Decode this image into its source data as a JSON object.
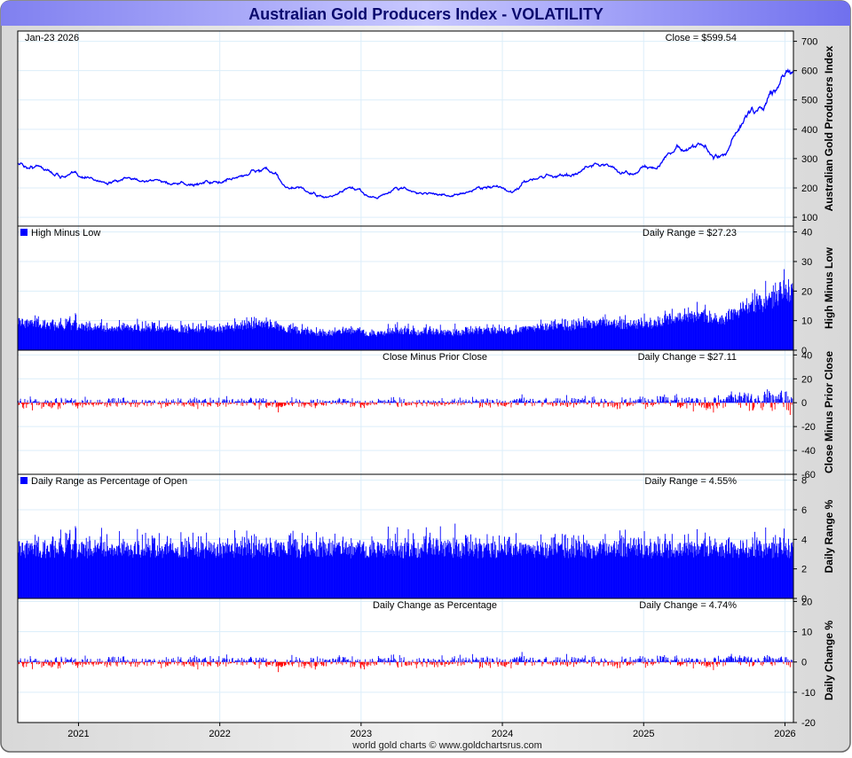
{
  "title": "Australian Gold Producers Index - VOLATILITY",
  "footer": "world gold charts © www.goldchartsrus.com",
  "date_label": "Jan-23  2026",
  "colors": {
    "line": "#0000ff",
    "negative": "#ff0000",
    "title_text": "#0a0a6e",
    "grid": "#dceefa"
  },
  "chart_data": [
    {
      "type": "line",
      "id": "close",
      "ylabel": "Australian Gold Producers Index",
      "annotation": "Close = $599.54",
      "ylim": [
        70,
        735
      ],
      "yticks": [
        100,
        200,
        300,
        400,
        500,
        600,
        700
      ],
      "x_start": 2020.57,
      "x_end": 2026.06,
      "xticks": [
        "2021",
        "2022",
        "2023",
        "2024",
        "2025",
        "2026"
      ],
      "monthly_close": [
        285,
        270,
        275,
        250,
        240,
        245,
        235,
        225,
        215,
        225,
        230,
        225,
        225,
        215,
        210,
        210,
        225,
        215,
        230,
        240,
        255,
        265,
        235,
        200,
        195,
        180,
        165,
        175,
        195,
        190,
        170,
        175,
        200,
        195,
        180,
        185,
        175,
        175,
        180,
        200,
        205,
        200,
        185,
        215,
        235,
        245,
        240,
        250,
        260,
        285,
        280,
        255,
        245,
        265,
        275,
        300,
        340,
        330,
        350,
        300,
        305,
        380,
        460,
        470,
        520,
        600
      ],
      "last": 599.54
    },
    {
      "type": "bar",
      "id": "range",
      "legend": "High Minus Low",
      "ylabel": "High Minus Low",
      "annotation": "Daily Range = $27.23",
      "ylim": [
        0,
        42
      ],
      "yticks": [
        0,
        10,
        20,
        30,
        40
      ],
      "last": 27.23
    },
    {
      "type": "bar",
      "id": "change",
      "title": "Close Minus Prior Close",
      "ylabel": "Close Minus Prior Close",
      "annotation": "Daily Change = $27.11",
      "ylim": [
        -60,
        44
      ],
      "yticks": [
        -60,
        -40,
        -20,
        0,
        20,
        40
      ],
      "last": 27.11
    },
    {
      "type": "bar",
      "id": "rangepct",
      "legend": "Daily Range as Percentage of Open",
      "ylabel": "Daily Range %",
      "annotation": "Daily Range = 4.55%",
      "ylim": [
        0,
        8.4
      ],
      "yticks": [
        0,
        2,
        4,
        6,
        8
      ],
      "typical_pct": 3.6,
      "last": 4.55
    },
    {
      "type": "bar",
      "id": "changepct",
      "title": "Daily Change as Percentage",
      "ylabel": "Daily Change %",
      "annotation": "Daily Change = 4.74%",
      "ylim": [
        -20,
        21
      ],
      "yticks": [
        -20,
        -10,
        0,
        10,
        20
      ],
      "last": 4.74
    }
  ]
}
